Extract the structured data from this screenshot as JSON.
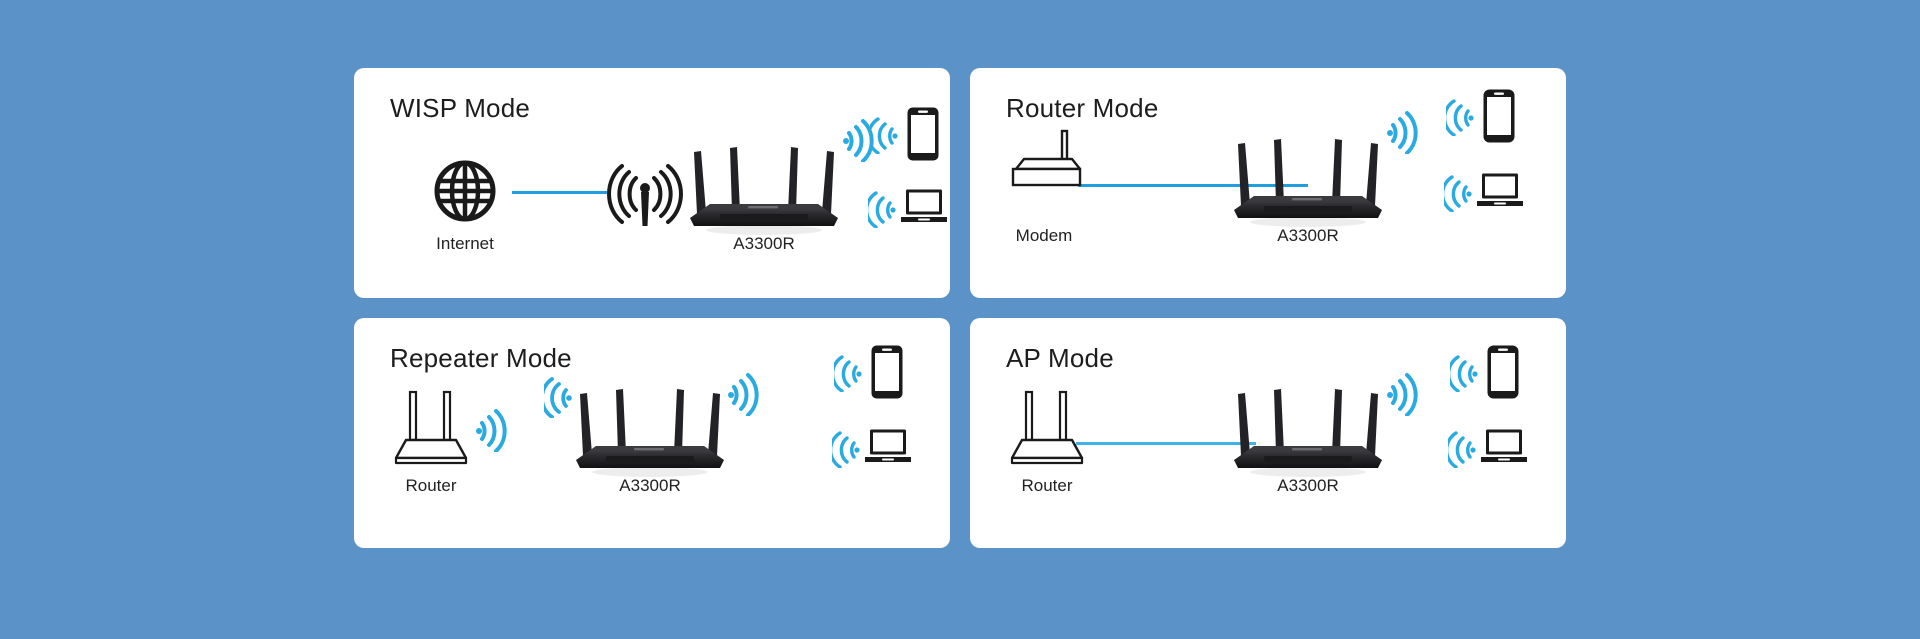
{
  "page": {
    "background_color": "#5b92c8",
    "card_color": "#ffffff",
    "accent_color": "#29abe2",
    "wire_color": "#1f9fe0",
    "text_color": "#1d1d1d"
  },
  "cards": [
    {
      "id": "wisp-mode",
      "title": "WISP Mode",
      "nodes": [
        {
          "name": "internet",
          "icon": "globe-icon",
          "label": "Internet"
        },
        {
          "name": "wireless-tower",
          "icon": "radio-tower-icon",
          "label": ""
        },
        {
          "name": "a3300r-router",
          "icon": "a3300r-router-icon",
          "label": "A3300R"
        },
        {
          "name": "smartphone-client",
          "icon": "smartphone-icon",
          "label": ""
        },
        {
          "name": "laptop-client",
          "icon": "laptop-icon",
          "label": ""
        }
      ],
      "links": [
        {
          "from": "internet",
          "to": "wireless-tower",
          "type": "wired-line"
        }
      ]
    },
    {
      "id": "router-mode",
      "title": "Router Mode",
      "nodes": [
        {
          "name": "modem",
          "icon": "modem-icon",
          "label": "Modem"
        },
        {
          "name": "a3300r-router",
          "icon": "a3300r-router-icon",
          "label": "A3300R"
        },
        {
          "name": "smartphone-client",
          "icon": "smartphone-icon",
          "label": ""
        },
        {
          "name": "laptop-client",
          "icon": "laptop-icon",
          "label": ""
        }
      ],
      "links": [
        {
          "from": "modem",
          "to": "a3300r-router",
          "type": "wired-line"
        }
      ]
    },
    {
      "id": "repeater-mode",
      "title": "Repeater Mode",
      "nodes": [
        {
          "name": "upstream-router",
          "icon": "generic-router-icon",
          "label": "Router"
        },
        {
          "name": "a3300r-router",
          "icon": "a3300r-router-icon",
          "label": "A3300R"
        },
        {
          "name": "smartphone-client",
          "icon": "smartphone-icon",
          "label": ""
        },
        {
          "name": "laptop-client",
          "icon": "laptop-icon",
          "label": ""
        }
      ],
      "links": [
        {
          "from": "upstream-router",
          "to": "a3300r-router",
          "type": "wireless"
        }
      ]
    },
    {
      "id": "ap-mode",
      "title": "AP Mode",
      "nodes": [
        {
          "name": "upstream-router",
          "icon": "generic-router-icon",
          "label": "Router"
        },
        {
          "name": "a3300r-router",
          "icon": "a3300r-router-icon",
          "label": "A3300R"
        },
        {
          "name": "smartphone-client",
          "icon": "smartphone-icon",
          "label": ""
        },
        {
          "name": "laptop-client",
          "icon": "laptop-icon",
          "label": ""
        }
      ],
      "links": [
        {
          "from": "upstream-router",
          "to": "a3300r-router",
          "type": "wired-line"
        }
      ]
    }
  ],
  "labels": {
    "wisp_title": "WISP Mode",
    "router_title": "Router Mode",
    "repeater_title": "Repeater Mode",
    "ap_title": "AP Mode",
    "internet": "Internet",
    "modem": "Modem",
    "router": "Router",
    "device_model": "A3300R"
  }
}
